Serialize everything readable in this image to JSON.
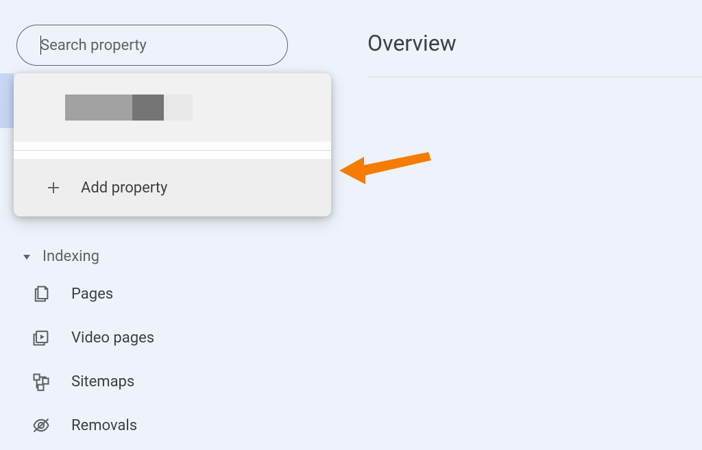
{
  "search": {
    "placeholder": "Search property"
  },
  "dropdown": {
    "add_property_label": "Add property"
  },
  "main": {
    "title": "Overview"
  },
  "sidebar": {
    "indexing": {
      "header": "Indexing",
      "items": [
        {
          "label": "Pages"
        },
        {
          "label": "Video pages"
        },
        {
          "label": "Sitemaps"
        },
        {
          "label": "Removals"
        }
      ]
    }
  }
}
